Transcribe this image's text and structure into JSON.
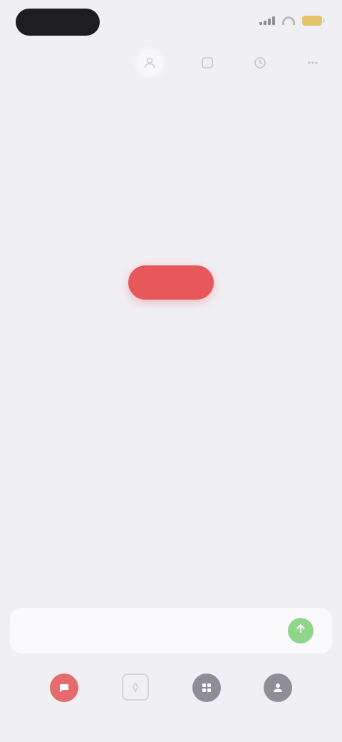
{
  "status_bar": {
    "time": "",
    "battery_color": "#e5c56a"
  },
  "toolbar": {
    "icons": [
      "person-icon",
      "square-icon",
      "clock-icon",
      "more-icon"
    ]
  },
  "page": {
    "title": "",
    "message_primary": "",
    "message_secondary": "",
    "cta_label": ""
  },
  "composer": {
    "placeholder": "",
    "send_color": "#8fd68a"
  },
  "tabbar": {
    "tabs": [
      {
        "icon": "chat-icon",
        "label": "",
        "state": "active"
      },
      {
        "icon": "compass-icon",
        "label": "",
        "state": "outline"
      },
      {
        "icon": "grid-icon",
        "label": "",
        "state": "dark"
      },
      {
        "icon": "profile-icon",
        "label": "",
        "state": "dark"
      }
    ],
    "accent": "#e56b6d"
  }
}
